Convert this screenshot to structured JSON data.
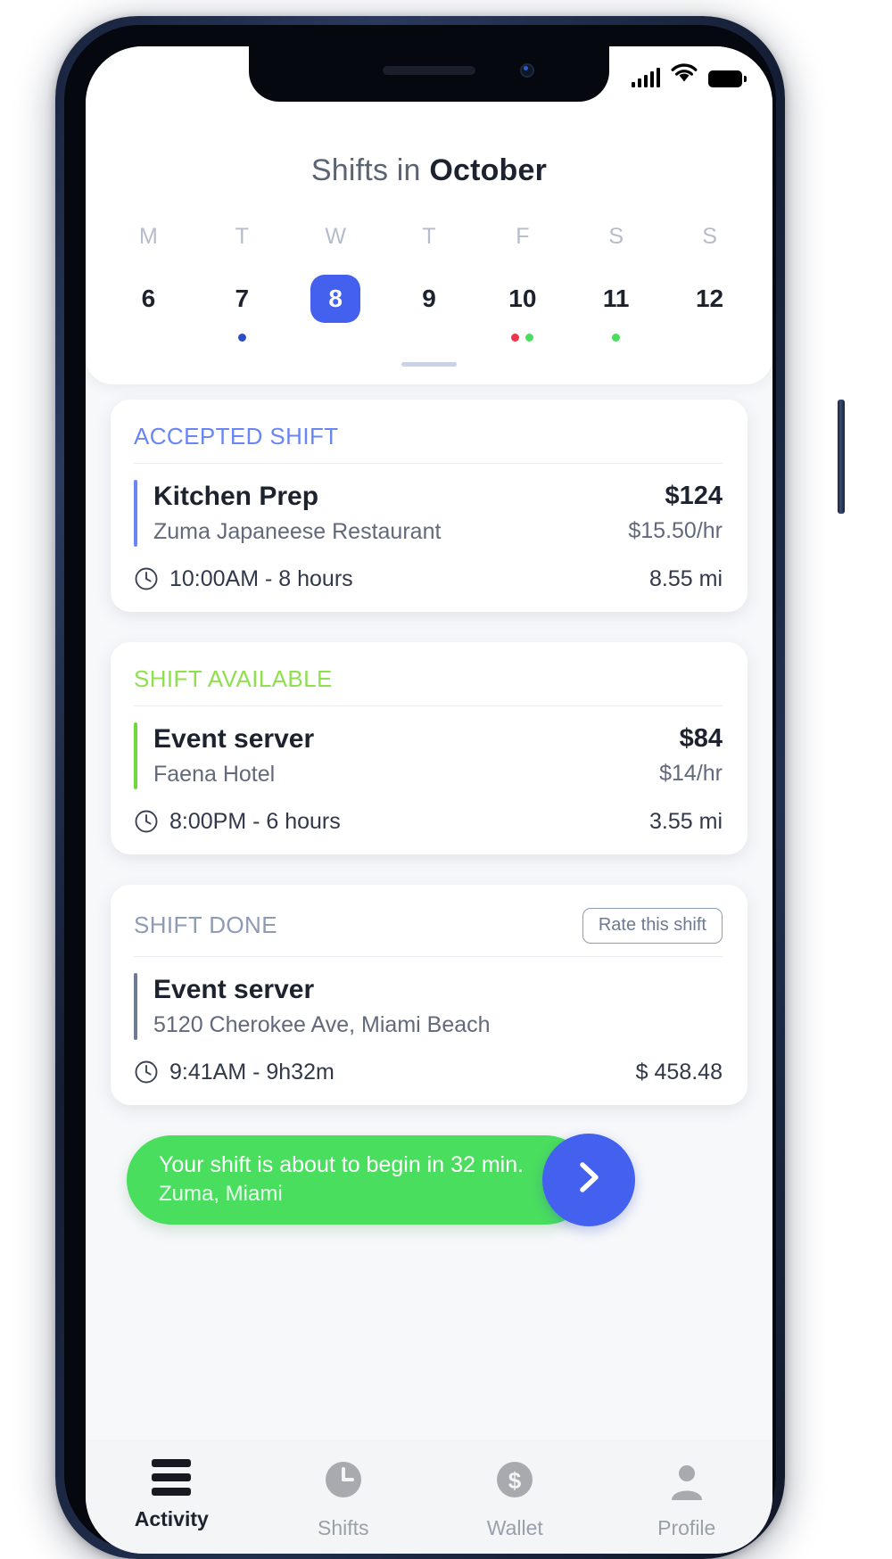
{
  "statusbar": {
    "signal_icon": "cellular-signal-icon",
    "wifi_icon": "wifi-icon",
    "battery_icon": "battery-icon"
  },
  "calendar": {
    "title_prefix": "Shifts in ",
    "title_month": "October",
    "weekdays": [
      "M",
      "T",
      "W",
      "T",
      "F",
      "S",
      "S"
    ],
    "days": [
      {
        "num": "6",
        "selected": false,
        "dots": []
      },
      {
        "num": "7",
        "selected": false,
        "dots": [
          "#2d4cc8"
        ]
      },
      {
        "num": "8",
        "selected": true,
        "dots": []
      },
      {
        "num": "9",
        "selected": false,
        "dots": []
      },
      {
        "num": "10",
        "selected": false,
        "dots": [
          "#f0354a",
          "#4ade5e"
        ]
      },
      {
        "num": "11",
        "selected": false,
        "dots": [
          "#4ade5e"
        ]
      },
      {
        "num": "12",
        "selected": false,
        "dots": []
      }
    ],
    "selected_color": "#4361ee",
    "drag_handle": "drag-handle"
  },
  "shifts": [
    {
      "status_label": "ACCEPTED SHIFT",
      "status_color": "#6a85f5",
      "accent_color": "#6a85f5",
      "title": "Kitchen Prep",
      "subtitle": "Zuma Japaneese Restaurant",
      "pay_total": "$124",
      "pay_rate": "$15.50/hr",
      "time": "10:00AM - 8 hours",
      "meta": "8.55 mi",
      "action": null
    },
    {
      "status_label": "SHIFT AVAILABLE",
      "status_color": "#8fe04f",
      "accent_color": "#6fd93c",
      "title": "Event server",
      "subtitle": "Faena Hotel",
      "pay_total": "$84",
      "pay_rate": "$14/hr",
      "time": "8:00PM - 6 hours",
      "meta": "3.55 mi",
      "action": null
    },
    {
      "status_label": "SHIFT DONE",
      "status_color": "#8d9bb5",
      "accent_color": "#6c7a93",
      "title": "Event server",
      "subtitle": "5120 Cherokee Ave, Miami Beach",
      "pay_total": "",
      "pay_rate": "",
      "time": "9:41AM - 9h32m",
      "meta": "$ 458.48",
      "action": "Rate this shift"
    }
  ],
  "banner": {
    "line1": "Your shift is about to begin in 32 min.",
    "line2": "Zuma, Miami",
    "background": "#4ade5e",
    "button_color": "#4361ee",
    "button_icon": "chevron-right-icon"
  },
  "tabbar": {
    "items": [
      {
        "label": "Activity",
        "icon": "menu-hamburger-icon",
        "active": true
      },
      {
        "label": "Shifts",
        "icon": "clock-icon",
        "active": false
      },
      {
        "label": "Wallet",
        "icon": "dollar-circle-icon",
        "active": false
      },
      {
        "label": "Profile",
        "icon": "person-icon",
        "active": false
      }
    ]
  }
}
